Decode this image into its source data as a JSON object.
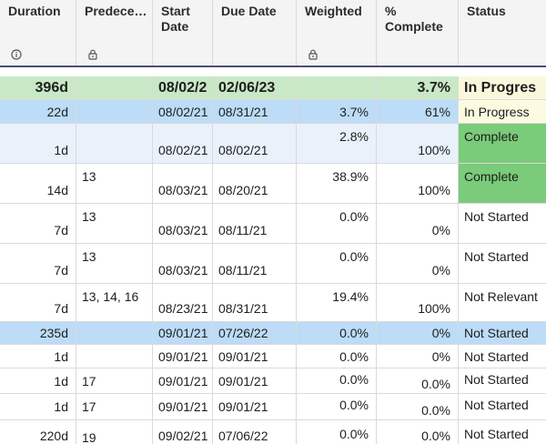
{
  "columns": [
    {
      "label": "Duration",
      "icon": "info-icon"
    },
    {
      "label": "Predece…",
      "icon": "lock-icon"
    },
    {
      "label": "Start\nDate",
      "icon": ""
    },
    {
      "label": "Due Date",
      "icon": ""
    },
    {
      "label": "Weighted",
      "icon": "lock-icon"
    },
    {
      "label": "%\nComplete",
      "icon": ""
    },
    {
      "label": "Status",
      "icon": ""
    }
  ],
  "rows": [
    {
      "duration": "396d",
      "pred": "",
      "start": "08/02/2",
      "due": "02/06/23",
      "weighted": "",
      "pct": "3.7%",
      "status": "In Progres"
    },
    {
      "duration": "22d",
      "pred": "",
      "start": "08/02/21",
      "due": "08/31/21",
      "weighted": "3.7%",
      "pct": "61%",
      "status": "In Progress"
    },
    {
      "duration": "1d",
      "pred": "",
      "start": "08/02/21",
      "due": "08/02/21",
      "weighted": "2.8%",
      "pct": "100%",
      "status": "Complete"
    },
    {
      "duration": "14d",
      "pred": "13",
      "start": "08/03/21",
      "due": "08/20/21",
      "weighted": "38.9%",
      "pct": "100%",
      "status": "Complete"
    },
    {
      "duration": "7d",
      "pred": "13",
      "start": "08/03/21",
      "due": "08/11/21",
      "weighted": "0.0%",
      "pct": "0%",
      "status": "Not Started"
    },
    {
      "duration": "7d",
      "pred": "13",
      "start": "08/03/21",
      "due": "08/11/21",
      "weighted": "0.0%",
      "pct": "0%",
      "status": "Not Started"
    },
    {
      "duration": "7d",
      "pred": "13, 14, 16",
      "start": "08/23/21",
      "due": "08/31/21",
      "weighted": "19.4%",
      "pct": "100%",
      "status": "Not Relevant"
    },
    {
      "duration": "235d",
      "pred": "",
      "start": "09/01/21",
      "due": "07/26/22",
      "weighted": "0.0%",
      "pct": "0%",
      "status": "Not Started"
    },
    {
      "duration": "1d",
      "pred": "",
      "start": "09/01/21",
      "due": "09/01/21",
      "weighted": "0.0%",
      "pct": "0%",
      "status": "Not Started"
    },
    {
      "duration": "1d",
      "pred": "17",
      "start": "09/01/21",
      "due": "09/01/21",
      "weighted": "0.0%",
      "pct": "0.0%",
      "status": "Not Started"
    },
    {
      "duration": "1d",
      "pred": "17",
      "start": "09/01/21",
      "due": "09/01/21",
      "weighted": "0.0%",
      "pct": "0.0%",
      "status": "Not Started"
    },
    {
      "duration": "220d",
      "pred": "19",
      "start": "09/02/21",
      "due": "07/06/22",
      "weighted": "0.0%",
      "pct": "0.0%",
      "status": "Not Started"
    }
  ],
  "colors": {
    "summary_row": "#c9e8c6",
    "summary_status": "#fbf7dc",
    "selected_row": "#bcdcf7",
    "tinted_row": "#e9f1fb",
    "complete_status": "#7acb7a",
    "progress_status": "#fcfae1",
    "header_bg": "#f4f4f4",
    "header_rule": "#4a4f7a"
  }
}
